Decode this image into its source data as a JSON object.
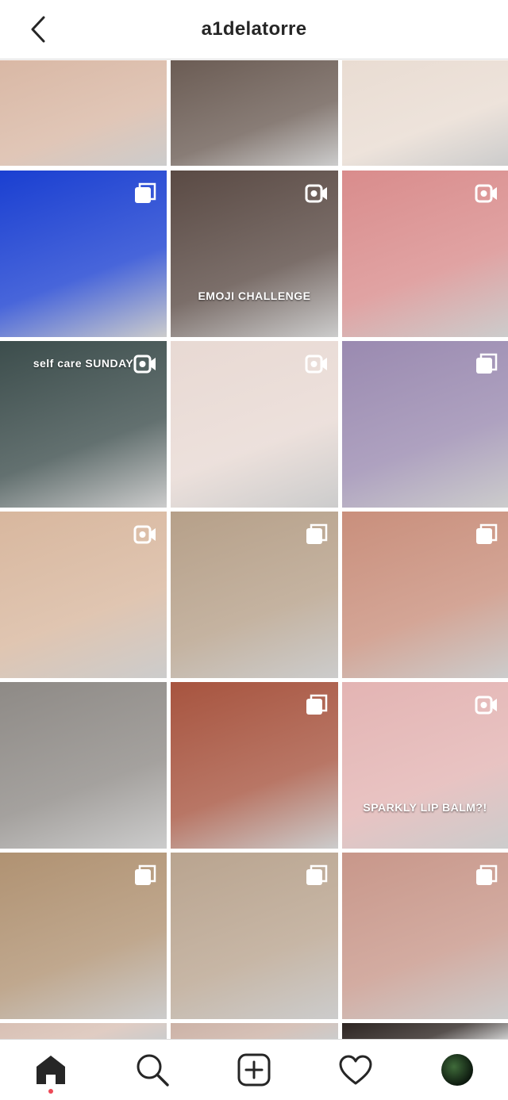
{
  "header": {
    "username": "a1delatorre"
  },
  "posts": [
    {
      "kind": "none",
      "color": "#d9b8a5"
    },
    {
      "kind": "none",
      "color": "#6b5c54"
    },
    {
      "kind": "none",
      "color": "#e9dcd2"
    },
    {
      "kind": "carousel",
      "color": "#1a3fd1"
    },
    {
      "kind": "video",
      "color": "#5a4a44",
      "caption": "EMOJI CHALLENGE"
    },
    {
      "kind": "video",
      "color": "#d98c8c"
    },
    {
      "kind": "video",
      "color": "#3c4d4c",
      "caption": "self care SUNDAY"
    },
    {
      "kind": "video",
      "color": "#e8d9d3"
    },
    {
      "kind": "carousel",
      "color": "#9a8ab0"
    },
    {
      "kind": "video",
      "color": "#d8b79e"
    },
    {
      "kind": "carousel",
      "color": "#b6a089"
    },
    {
      "kind": "carousel",
      "color": "#c98f7c"
    },
    {
      "kind": "none",
      "color": "#8e8a86"
    },
    {
      "kind": "carousel",
      "color": "#a7543f"
    },
    {
      "kind": "video",
      "color": "#e3b4b3",
      "caption": "SPARKLY LIP BALM?!"
    },
    {
      "kind": "carousel",
      "color": "#b09272"
    },
    {
      "kind": "carousel",
      "color": "#b9a48f"
    },
    {
      "kind": "carousel",
      "color": "#c8978a"
    },
    {
      "kind": "none",
      "color": "#d8c0b4"
    },
    {
      "kind": "none",
      "color": "#ccb2a6"
    },
    {
      "kind": "none",
      "color": "#2d2522"
    }
  ],
  "tabs": [
    {
      "name": "home",
      "active": true
    },
    {
      "name": "search",
      "active": false
    },
    {
      "name": "new-post",
      "active": false
    },
    {
      "name": "activity",
      "active": false
    },
    {
      "name": "profile",
      "active": false
    }
  ]
}
